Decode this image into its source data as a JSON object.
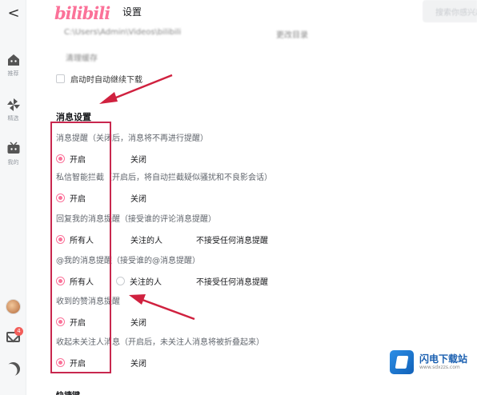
{
  "header": {
    "logo": "bilibili",
    "title": "设置",
    "search_placeholder": "搜索你感兴趣的视频"
  },
  "sidebar": {
    "back": "<",
    "items": [
      {
        "label": "推荐",
        "icon": "home-icon"
      },
      {
        "label": "精选",
        "icon": "pinwheel-icon"
      },
      {
        "label": "我的",
        "icon": "tv-icon"
      }
    ],
    "message_badge": "4"
  },
  "top_blur": {
    "path_text": "C:\\Users\\Admin\\Videos\\bilibili",
    "change_dir": "更改目录",
    "cache_text": "清理缓存"
  },
  "auto_resume": {
    "label": "启动时自动继续下载",
    "checked": false
  },
  "message_settings": {
    "section_title": "消息设置",
    "settings": [
      {
        "label": "消息提醒（关闭后，消息将不再进行提醒）",
        "options": [
          "开启",
          "关闭"
        ],
        "selected": 0
      },
      {
        "label": "私信智能拦截（开启后，将自动拦截疑似骚扰和不良影会话）",
        "options": [
          "开启",
          "关闭"
        ],
        "selected": 0
      },
      {
        "label": "回复我的消息提醒（接受谁的评论消息提醒）",
        "options": [
          "所有人",
          "关注的人",
          "不接受任何消息提醒"
        ],
        "selected": 0
      },
      {
        "label": "@我的消息提醒（接受谁的@消息提醒）",
        "options": [
          "所有人",
          "关注的人",
          "不接受任何消息提醒"
        ],
        "selected": 0
      },
      {
        "label": "收到的赞消息提醒",
        "options": [
          "开启",
          "关闭"
        ],
        "selected": 0
      },
      {
        "label": "收起未关注人消息（开启后，未关注人消息将被折叠起来）",
        "options": [
          "开启",
          "关闭"
        ],
        "selected": 0
      }
    ]
  },
  "bottom_section": "快捷键",
  "watermark": {
    "title": "闪电下载站",
    "url": "www.sdxzzs.com"
  },
  "colors": {
    "accent": "#fb7299",
    "annotation": "#c8274e"
  }
}
